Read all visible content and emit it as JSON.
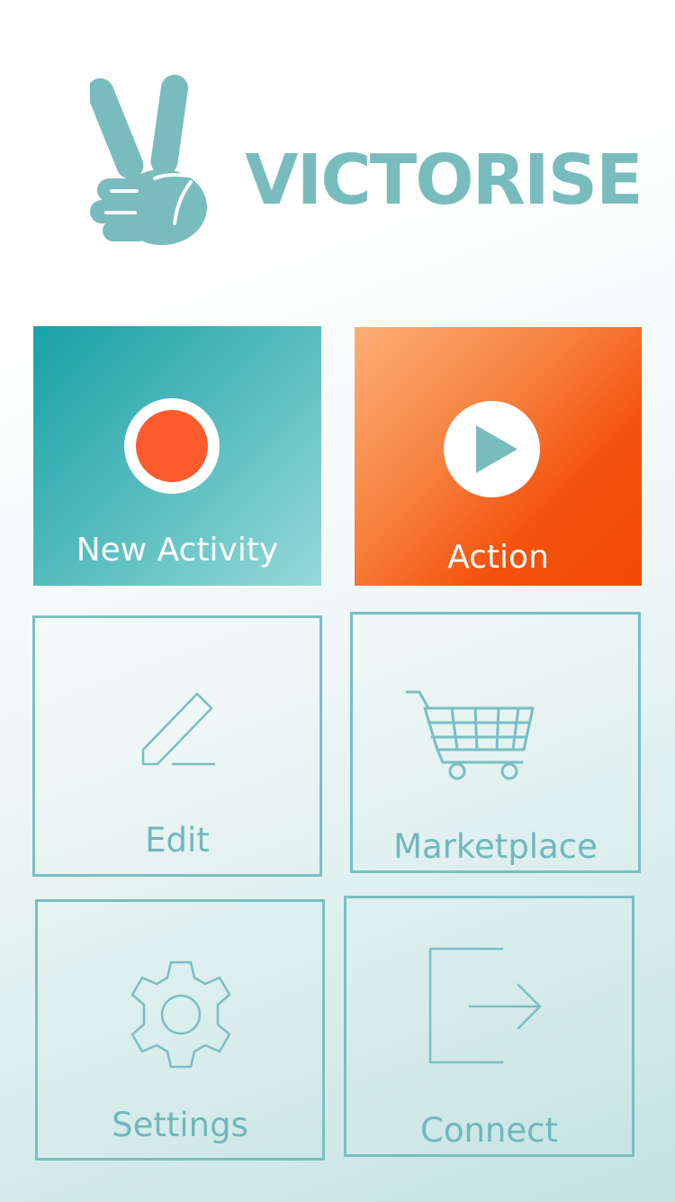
{
  "app": {
    "brand_name": "VICTORISE",
    "logo_icon": "victory-hand-icon"
  },
  "colors": {
    "brand_teal": "#79bcbd",
    "new_activity_tile": "#4fb9bb",
    "action_tile": "#f3520d",
    "record_dot": "#fe5b2d",
    "outline": "#79bfc2",
    "background_bottom": "#c4e2e2"
  },
  "menu": {
    "new_activity": {
      "label": "New Activity",
      "icon": "record-icon"
    },
    "action": {
      "label": "Action",
      "icon": "play-icon"
    },
    "edit": {
      "label": "Edit",
      "icon": "pencil-icon"
    },
    "marketplace": {
      "label": "Marketplace",
      "icon": "shopping-cart-icon"
    },
    "settings": {
      "label": "Settings",
      "icon": "gear-icon"
    },
    "connect": {
      "label": "Connect",
      "icon": "sign-in-icon"
    }
  }
}
